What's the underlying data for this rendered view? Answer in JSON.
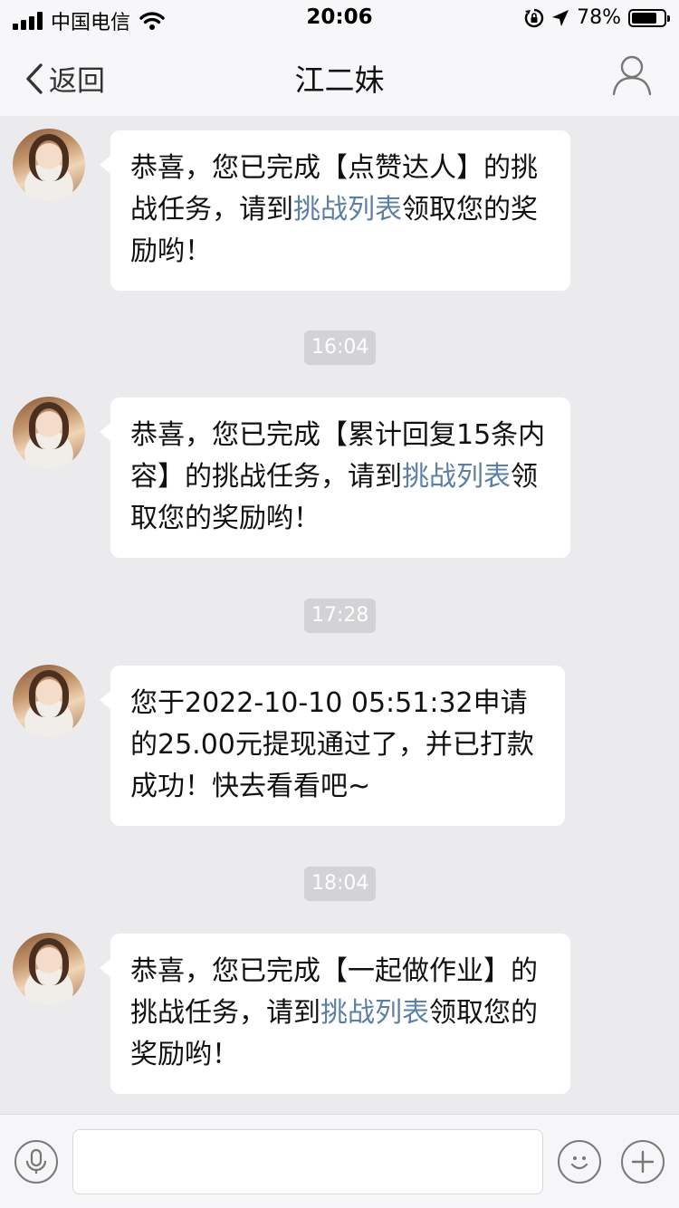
{
  "status_bar": {
    "carrier": "中国电信",
    "time": "20:06",
    "battery_percent_label": "78%",
    "battery_level": 0.78
  },
  "nav": {
    "back_label": "返回",
    "title": "江二妹"
  },
  "messages": [
    {
      "kind": "message",
      "parts": {
        "p1": "恭喜，您已完成【点赞达人】的挑战任务，请到",
        "link": "挑战列表",
        "p2": "领取您的奖励哟！"
      }
    },
    {
      "kind": "time",
      "text": "16:04"
    },
    {
      "kind": "message",
      "parts": {
        "p1": "恭喜，您已完成【累计回复15条内容】的挑战任务，请到",
        "link": "挑战列表",
        "p2": "领取您的奖励哟！"
      }
    },
    {
      "kind": "time",
      "text": "17:28"
    },
    {
      "kind": "message",
      "parts": {
        "p1": "您于2022-10-10 05:51:32申请的25.00元提现通过了，并已打款成功！快去看看吧~"
      }
    },
    {
      "kind": "time",
      "text": "18:04"
    },
    {
      "kind": "message",
      "parts": {
        "p1": "恭喜，您已完成【一起做作业】的挑战任务，请到",
        "link": "挑战列表",
        "p2": "领取您的奖励哟！"
      }
    }
  ],
  "input_bar": {
    "text_value": ""
  },
  "colors": {
    "link": "#5b7fa6",
    "chat_background": "#ebebee",
    "bubble": "#ffffff",
    "time_pill": "#d3d3d6"
  },
  "icons": {
    "back": "chevron-left-icon",
    "profile": "person-icon",
    "voice": "microphone-icon",
    "emoji": "smiley-icon",
    "more": "plus-icon"
  }
}
